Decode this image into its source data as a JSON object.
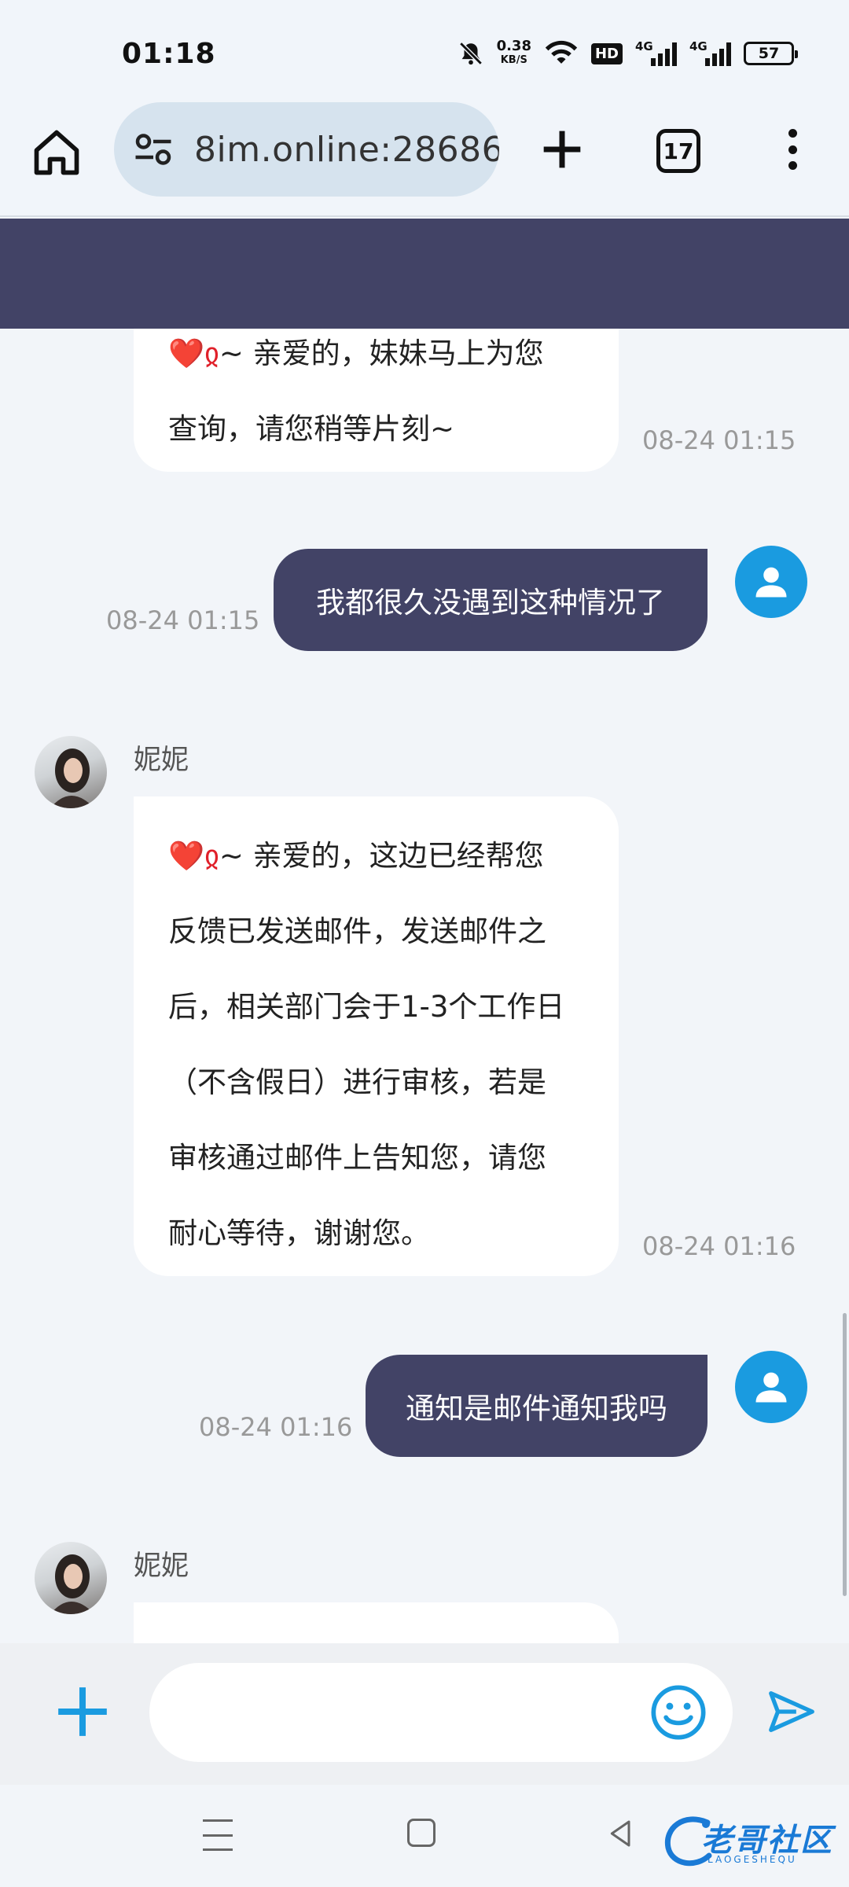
{
  "status_bar": {
    "time": "01:18",
    "net_speed_value": "0.38",
    "net_speed_unit": "KB/S",
    "hd_label": "HD",
    "signal1_label": "4G",
    "signal2_label": "4G",
    "battery": "57"
  },
  "browser": {
    "url": "8im.online:28686",
    "tab_count": "17"
  },
  "chat": {
    "messages": [
      {
        "sender": "agent",
        "text": "~ 亲爱的，妹妹马上为您\n查询，请您稍等片刻~",
        "time": "08-24 01:15"
      },
      {
        "sender": "user",
        "text": "我都很久没遇到这种情况了",
        "time": "08-24 01:15"
      },
      {
        "sender": "agent",
        "name": "妮妮",
        "text": "~ 亲爱的，这边已经帮您\n反馈已发送邮件，发送邮件之\n后，相关部门会于1-3个工作日\n（不含假日）进行审核，若是\n审核通过邮件上告知您，请您\n耐心等待，谢谢您。",
        "time": "08-24 01:16"
      },
      {
        "sender": "user",
        "text": "通知是邮件通知我吗",
        "time": "08-24 01:16"
      },
      {
        "sender": "agent",
        "name": "妮妮",
        "text": ""
      }
    ],
    "heart_glyph": "❤️ჲ"
  },
  "input": {
    "value": "",
    "placeholder": ""
  },
  "watermark": {
    "title": "老哥社区",
    "subtitle": "LAOGESHEQU"
  },
  "colors": {
    "header": "#424366",
    "user_bubble": "#424366",
    "accent": "#1a9be0"
  }
}
